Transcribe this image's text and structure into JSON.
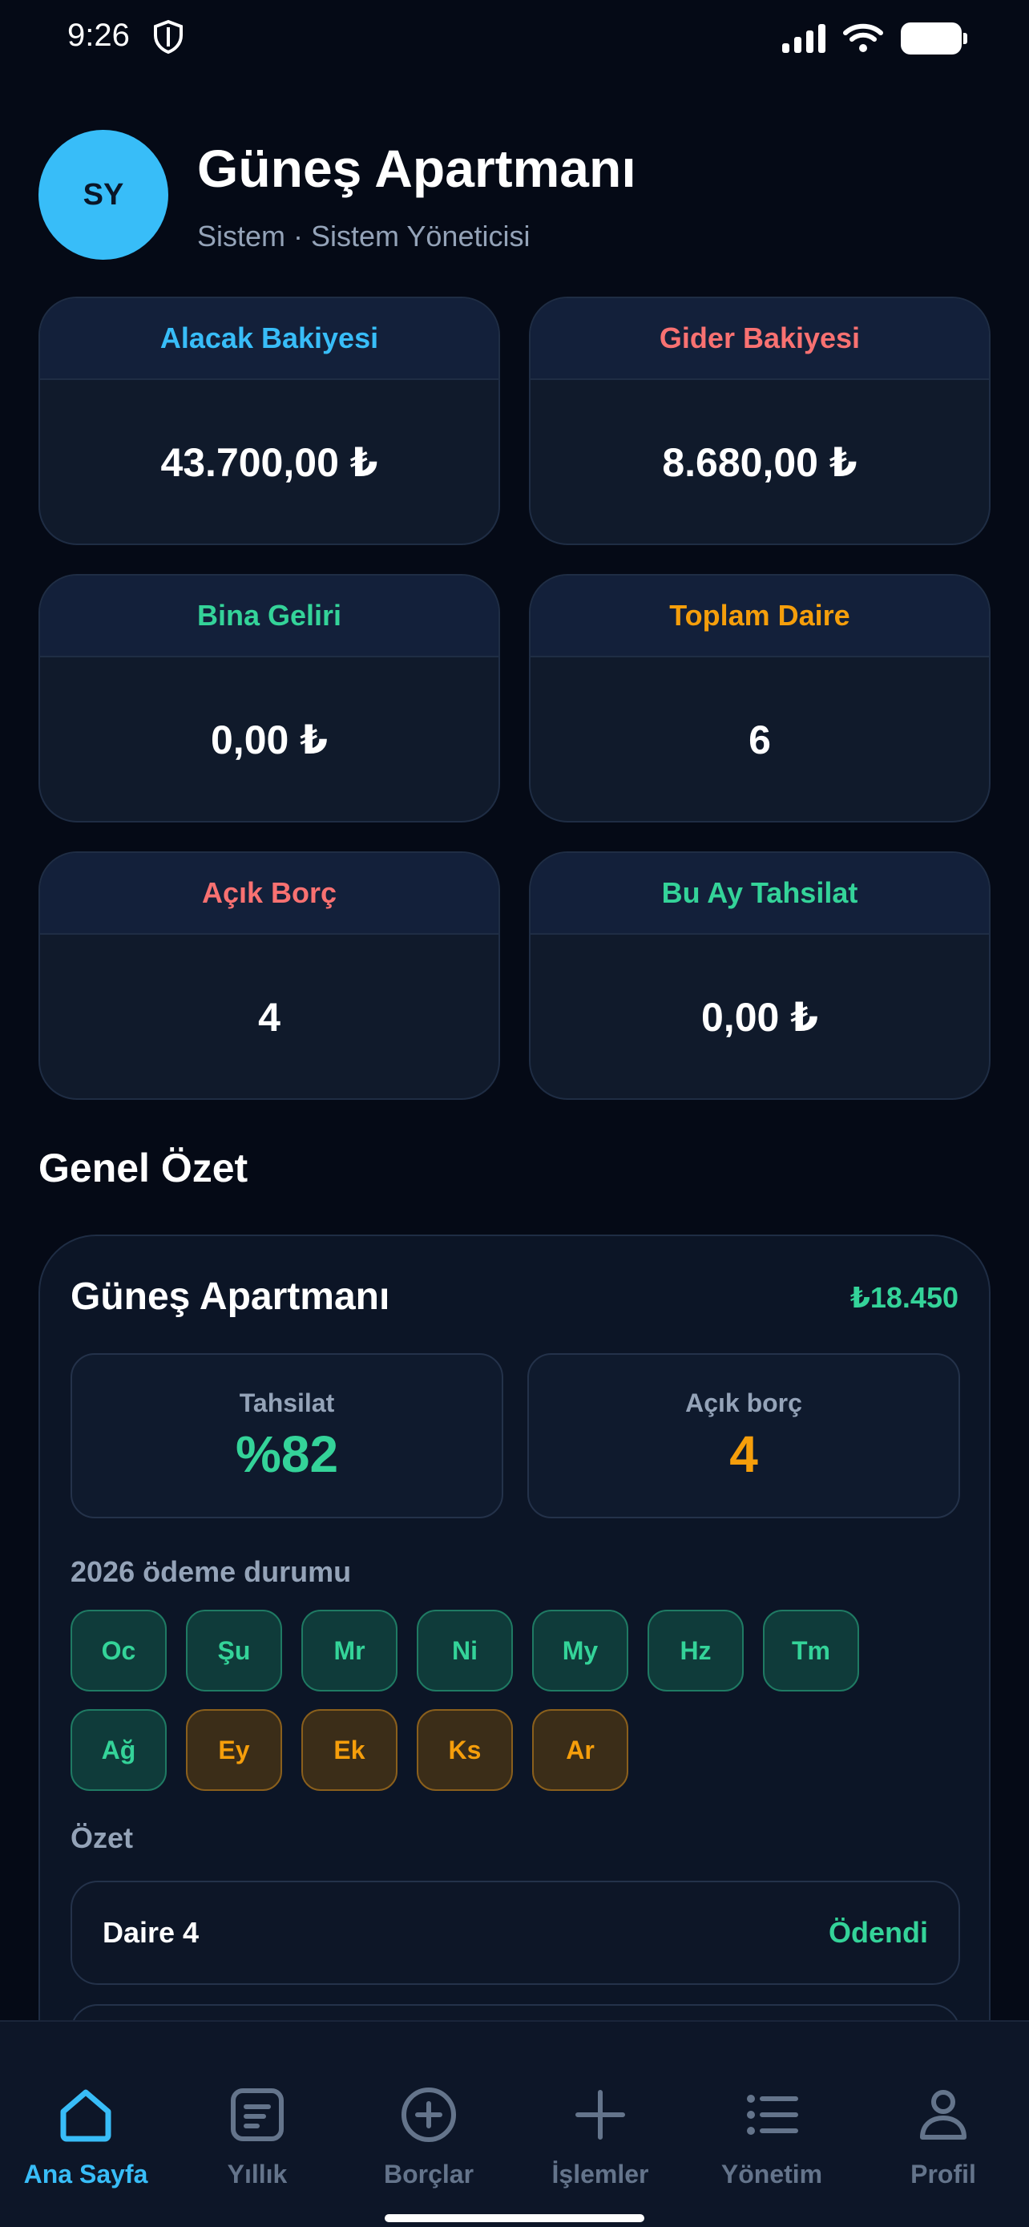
{
  "status_bar": {
    "time": "9:26"
  },
  "header": {
    "avatar_initials": "SY",
    "building_name": "Güneş Apartmanı",
    "subtitle": "Sistem · Sistem Yöneticisi"
  },
  "stats": [
    {
      "label": "Alacak Bakiyesi",
      "value": "43.700,00 ₺",
      "color": "#38bdf8"
    },
    {
      "label": "Gider Bakiyesi",
      "value": "8.680,00 ₺",
      "color": "#f87171"
    },
    {
      "label": "Bina Geliri",
      "value": "0,00 ₺",
      "color": "#34d399"
    },
    {
      "label": "Toplam Daire",
      "value": "6",
      "color": "#f59e0b"
    },
    {
      "label": "Açık Borç",
      "value": "4",
      "color": "#f87171"
    },
    {
      "label": "Bu Ay Tahsilat",
      "value": "0,00 ₺",
      "color": "#34d399"
    }
  ],
  "overview": {
    "section_title": "Genel Özet",
    "building_name": "Güneş Apartmanı",
    "amount": "₺18.450",
    "collection_label": "Tahsilat",
    "collection_value": "%82",
    "open_debt_label": "Açık borç",
    "open_debt_value": "4",
    "payment_status_title": "2026 ödeme durumu",
    "months": [
      {
        "label": "Oc",
        "status": "paid"
      },
      {
        "label": "Şu",
        "status": "paid"
      },
      {
        "label": "Mr",
        "status": "paid"
      },
      {
        "label": "Ni",
        "status": "paid"
      },
      {
        "label": "My",
        "status": "paid"
      },
      {
        "label": "Hz",
        "status": "paid"
      },
      {
        "label": "Tm",
        "status": "paid"
      },
      {
        "label": "Ağ",
        "status": "paid"
      },
      {
        "label": "Ey",
        "status": "unpaid"
      },
      {
        "label": "Ek",
        "status": "unpaid"
      },
      {
        "label": "Ks",
        "status": "unpaid"
      },
      {
        "label": "Ar",
        "status": "unpaid"
      }
    ],
    "summary_title": "Özet",
    "summary_rows": [
      {
        "unit": "Daire 4",
        "status": "Ödendi"
      }
    ]
  },
  "nav": {
    "items": [
      {
        "label": "Ana Sayfa",
        "icon": "home-icon"
      },
      {
        "label": "Yıllık",
        "icon": "annual-report-icon"
      },
      {
        "label": "Borçlar",
        "icon": "plus-circle-icon"
      },
      {
        "label": "İşlemler",
        "icon": "plus-icon"
      },
      {
        "label": "Yönetim",
        "icon": "list-icon"
      },
      {
        "label": "Profil",
        "icon": "profile-icon"
      }
    ],
    "active_index": 0
  },
  "colors": {
    "accent": "#38bdf8",
    "paid": "#34d399",
    "unpaid": "#f59e0b",
    "danger": "#f87171",
    "background": "#050a16"
  }
}
